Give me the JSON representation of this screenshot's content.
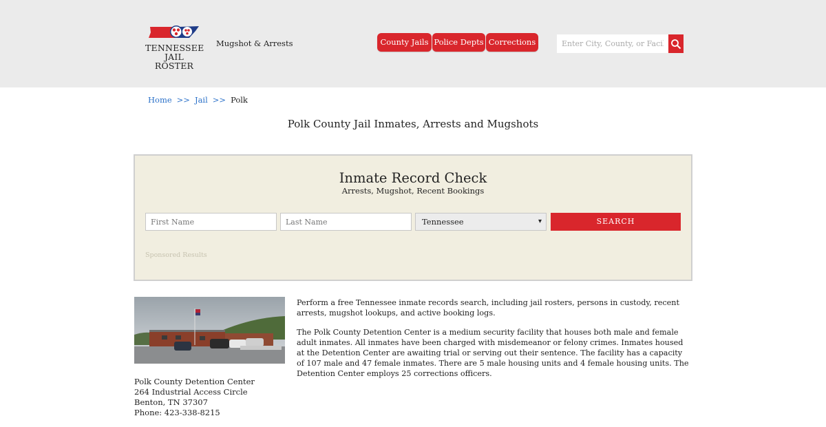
{
  "header": {
    "logo_line1": "TENNESSEE",
    "logo_line2": "JAIL ROSTER",
    "tagline": "Mugshot & Arrests",
    "nav": [
      "County Jails",
      "Police Depts",
      "Corrections"
    ],
    "search_placeholder": "Enter City, County, or Facility"
  },
  "breadcrumb": {
    "home": "Home",
    "sep": ">>",
    "jail": "Jail",
    "current": "Polk"
  },
  "page_title": "Polk County Jail Inmates, Arrests and Mugshots",
  "record_check": {
    "title": "Inmate Record Check",
    "subtitle": "Arrests, Mugshot, Recent Bookings",
    "first_name_placeholder": "First Name",
    "last_name_placeholder": "Last Name",
    "state_selected": "Tennessee",
    "search_label": "SEARCH",
    "sponsored": "Sponsored Results"
  },
  "facility": {
    "name": "Polk County Detention Center",
    "street": "264 Industrial Access Circle",
    "city_state_zip": "Benton, TN 37307",
    "phone": "Phone: 423-338-8215"
  },
  "paragraphs": [
    "Perform a free Tennessee inmate records search, including jail rosters, persons in custody, recent arrests, mugshot lookups, and active booking logs.",
    "The Polk County Detention Center is a medium security facility that houses both male and female adult inmates. All inmates have been charged with misdemeanor or felony crimes. Inmates housed at the Detention Center are awaiting trial or serving out their sentence. The facility has a capacity of 107 male and 47 female inmates. There are 5 male housing units and 4 female housing units. The Detention Center employs 25 corrections officers."
  ],
  "colors": {
    "accent_red": "#d9262c",
    "header_bg": "#ebebeb",
    "panel_bg": "#f1eee0",
    "link_blue": "#2b71c9"
  },
  "icons": {
    "search": "magnifier-icon",
    "select": "chevron-down-icon"
  }
}
